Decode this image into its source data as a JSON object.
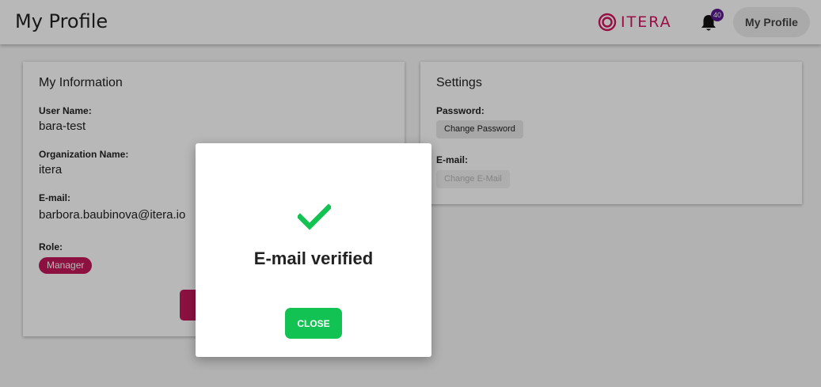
{
  "header": {
    "page_title": "My Profile",
    "logo_text": "ITERA",
    "notification_count": "40",
    "profile_button": "My Profile",
    "brand_color": "#d3135f"
  },
  "my_information": {
    "title": "My Information",
    "user_name_label": "User Name:",
    "user_name": "bara-test",
    "organization_label": "Organization Name:",
    "organization": "itera",
    "email_label": "E-mail:",
    "email": "barbora.baubinova@itera.io",
    "role_label": "Role:",
    "role": "Manager",
    "role_color": "#c2185b"
  },
  "settings": {
    "title": "Settings",
    "password_label": "Password:",
    "change_password": "Change Password",
    "email_label": "E-mail:",
    "change_email": "Change E-Mail"
  },
  "modal": {
    "icon": "check-icon",
    "message": "E-mail verified",
    "close_label": "CLOSE",
    "accent_color": "#12c253"
  }
}
